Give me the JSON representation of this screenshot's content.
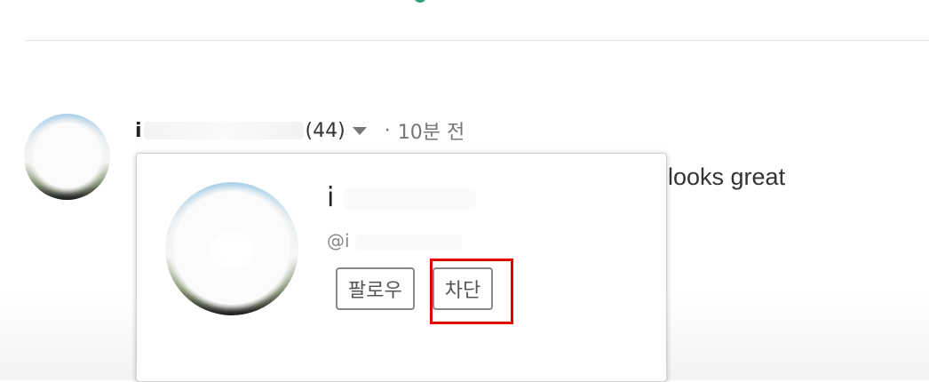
{
  "comment": {
    "author_initial": "i",
    "author_count": "(44)",
    "separator": "·",
    "time_ago": "10분 전",
    "body_visible": "looks great"
  },
  "profile_card": {
    "name_initial": "i",
    "handle_prefix": "@i",
    "follow_label": "팔로우",
    "block_label": "차단"
  },
  "colors": {
    "accent": "#2fa27b",
    "highlight": "#e00000"
  }
}
